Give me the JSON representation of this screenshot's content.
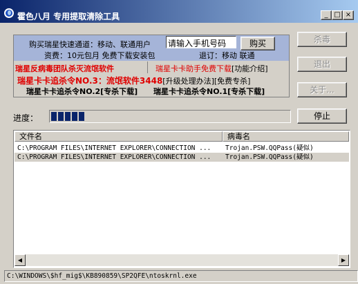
{
  "window": {
    "title": "霍色八月  专用提取清除工具",
    "controls": [
      "_",
      "□",
      "×"
    ]
  },
  "info": {
    "line1_text": "购买瑞星快速通道：移动、联通用户",
    "phone_placeholder": "请输入手机号码",
    "buy_button": "购买",
    "line2_left": "资费：10元包月  免费下载安装包",
    "line2_right": "退订：移动 联通",
    "promo_left": "瑞星反病毒团队杀灭流氓软件",
    "promo_right_red": "瑞星卡卡助手免费下载",
    "promo_right_black": "[功能介绍]",
    "order3_red": "瑞星卡卡追杀令NO.3：流氓软件3448",
    "order3_black": "[升级处理办法][免费专杀]",
    "order2": "瑞星卡卡追杀令NO.2[专杀下载]",
    "order1": "瑞星卡卡追杀令NO.1[专杀下载]"
  },
  "buttons": {
    "kill": "杀毒",
    "exit": "退出",
    "about": "关于...",
    "stop": "停止"
  },
  "progress": {
    "label": "进度：",
    "blocks": 5,
    "fraction": 0.14
  },
  "list": {
    "columns": [
      "文件名",
      "病毒名"
    ],
    "rows": [
      {
        "file": "C:\\PROGRAM FILES\\INTERNET EXPLORER\\CONNECTION ...",
        "virus": "Trojan.PSW.QQPass(疑似)"
      },
      {
        "file": "C:\\PROGRAM FILES\\INTERNET EXPLORER\\CONNECTION ...",
        "virus": "Trojan.PSW.QQPass(疑似)"
      }
    ]
  },
  "statusbar": "C:\\WINDOWS\\$hf_mig$\\KB890859\\SP2QFE\\ntoskrnl.exe",
  "colors": {
    "title_start": "#0a246a",
    "title_end": "#a6caf0",
    "info_blue": "#a5b4d8",
    "promo_red": "#e00000",
    "progress_fill": "#0a246a"
  }
}
